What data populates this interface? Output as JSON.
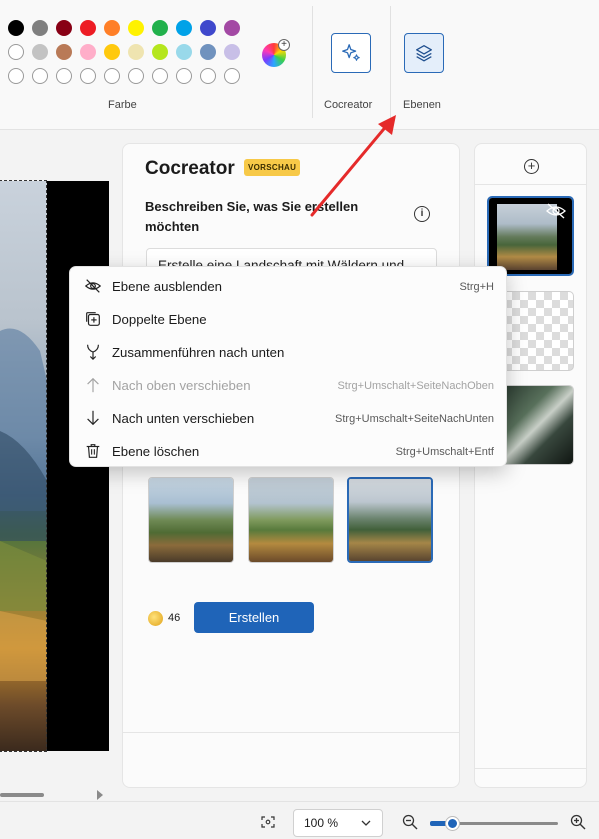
{
  "ribbon": {
    "color_label": "Farbe",
    "cocreator_label": "Cocreator",
    "layers_label": "Ebenen",
    "colors_row1": [
      "#000000",
      "#7f7f7f",
      "#880015",
      "#ed1c24",
      "#ff7f27",
      "#fff200",
      "#22b14c",
      "#00a2e8",
      "#3f48cc",
      "#a349a4"
    ],
    "colors_row2": [
      "#ffffff",
      "#c3c3c3",
      "#b97a57",
      "#ffaec9",
      "#ffc90e",
      "#efe4b0",
      "#b5e61d",
      "#99d9ea",
      "#7092be",
      "#c8bfe7"
    ]
  },
  "cocreator": {
    "title": "Cocreator",
    "badge": "VORSCHAU",
    "description": "Beschreiben Sie, was Sie erstellen möchten",
    "prompt": "Erstelle eine Landschaft mit Wäldern und",
    "credits": "46",
    "create_label": "Erstellen"
  },
  "context_menu": {
    "items": [
      {
        "label": "Ebene ausblenden",
        "shortcut": "Strg+H",
        "icon": "eye-hidden-icon",
        "enabled": true
      },
      {
        "label": "Doppelte Ebene",
        "shortcut": "",
        "icon": "duplicate-icon",
        "enabled": true
      },
      {
        "label": "Zusammenführen nach unten",
        "shortcut": "",
        "icon": "merge-down-icon",
        "enabled": true
      },
      {
        "label": "Nach oben verschieben",
        "shortcut": "Strg+Umschalt+SeiteNachOben",
        "icon": "arrow-up-icon",
        "enabled": false
      },
      {
        "label": "Nach unten verschieben",
        "shortcut": "Strg+Umschalt+SeiteNachUnten",
        "icon": "arrow-down-icon",
        "enabled": true
      },
      {
        "label": "Ebene löschen",
        "shortcut": "Strg+Umschalt+Entf",
        "icon": "trash-icon",
        "enabled": true
      }
    ]
  },
  "status": {
    "zoom": "100 %",
    "zoom_slider_fraction": 0.17
  },
  "accent_color": "#1f64b8"
}
